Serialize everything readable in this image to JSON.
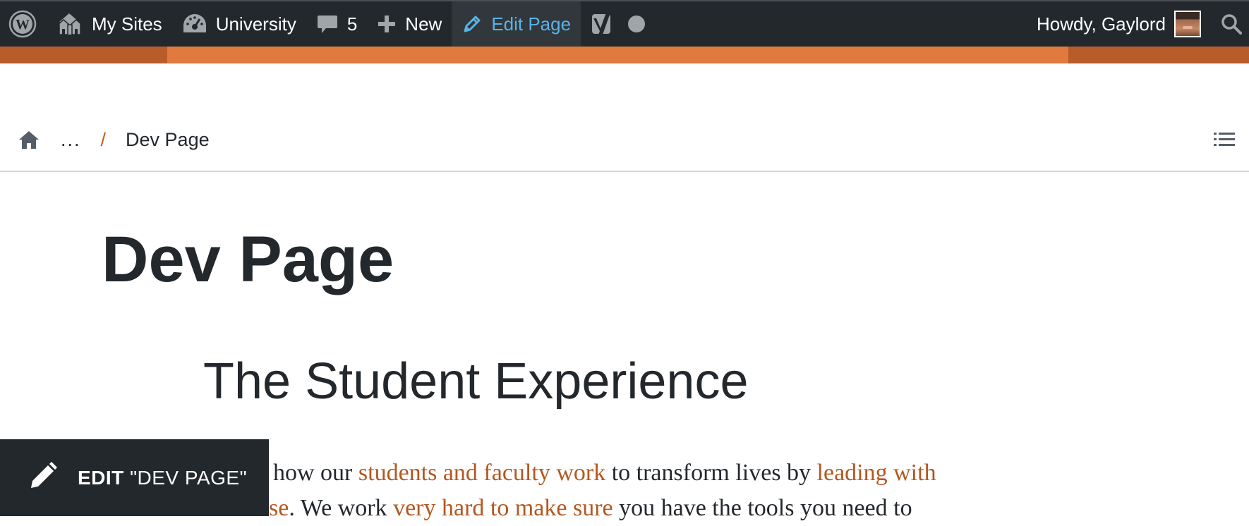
{
  "adminbar": {
    "my_sites": "My Sites",
    "site_name": "University",
    "comments_count": "5",
    "new_label": "New",
    "edit_page_label": "Edit Page",
    "greeting": "Howdy, Gaylord",
    "active_color": "#58b3e6"
  },
  "breadcrumb": {
    "ellipsis": "...",
    "separator": "/",
    "current": "Dev Page"
  },
  "content": {
    "page_title": "Dev Page",
    "section_title": "The Student Experience",
    "para_line1": {
      "t1": "how our ",
      "l1": "students and faculty work",
      "t2": " to transform lives by ",
      "l2": "leading with"
    },
    "para_line2": {
      "l0": "se",
      "t1": ". We work ",
      "l1": "very hard to make sure",
      "t2": " you have the tools you need to"
    },
    "link_color": "#b5571f"
  },
  "edit_button": {
    "prefix": "EDIT",
    "title": "\"DEV PAGE\""
  },
  "colors": {
    "adminbar_bg": "#23282d",
    "accent_orange": "#e07a3f",
    "accent_orange_dark": "#b85c2a"
  }
}
